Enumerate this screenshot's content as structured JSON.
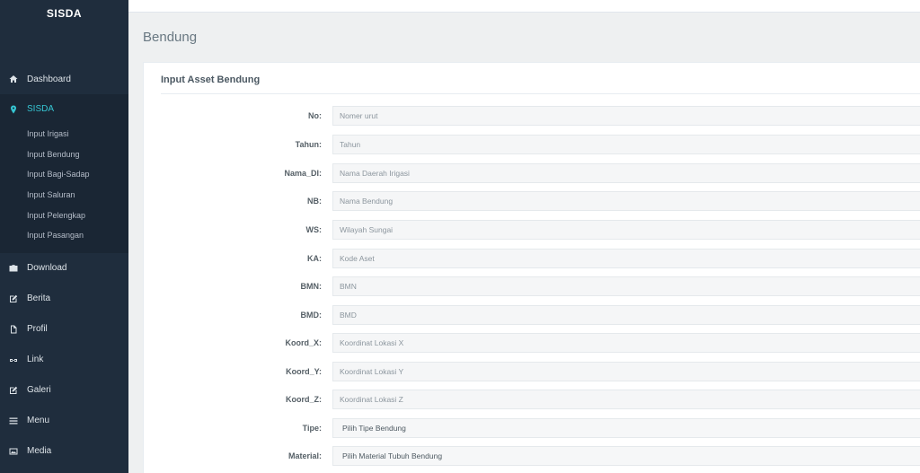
{
  "brand": "SISDA",
  "page_title": "Bendung",
  "panel_title": "Input Asset Bendung",
  "sidebar": {
    "items": [
      {
        "label": "Dashboard",
        "icon": "home-icon"
      },
      {
        "label": "SISDA",
        "icon": "map-pin-icon",
        "active": true
      },
      {
        "label": "Download",
        "icon": "briefcase-icon"
      },
      {
        "label": "Berita",
        "icon": "edit-icon"
      },
      {
        "label": "Profil",
        "icon": "file-icon"
      },
      {
        "label": "Link",
        "icon": "link-icon"
      },
      {
        "label": "Galeri",
        "icon": "edit-icon"
      },
      {
        "label": "Menu",
        "icon": "menu-icon"
      },
      {
        "label": "Media",
        "icon": "media-icon"
      }
    ],
    "sub_items": [
      "Input Irigasi",
      "Input Bendung",
      "Input Bagi-Sadap",
      "Input Saluran",
      "Input Pelengkap",
      "Input Pasangan"
    ]
  },
  "form": {
    "fields": [
      {
        "label": "No:",
        "placeholder": "Nomer urut"
      },
      {
        "label": "Tahun:",
        "placeholder": "Tahun"
      },
      {
        "label": "Nama_DI:",
        "placeholder": "Nama Daerah Irigasi"
      },
      {
        "label": "NB:",
        "placeholder": "Nama Bendung"
      },
      {
        "label": "WS:",
        "placeholder": "Wilayah Sungai"
      },
      {
        "label": "KA:",
        "placeholder": "Kode Aset"
      },
      {
        "label": "BMN:",
        "placeholder": "BMN"
      },
      {
        "label": "BMD:",
        "placeholder": "BMD"
      },
      {
        "label": "Koord_X:",
        "placeholder": "Koordinat Lokasi X"
      },
      {
        "label": "Koord_Y:",
        "placeholder": "Koordinat Lokasi Y"
      },
      {
        "label": "Koord_Z:",
        "placeholder": "Koordinat Lokasi Z"
      },
      {
        "label": "Tipe:",
        "selected": "Pilih Tipe Bendung"
      },
      {
        "label": "Material:",
        "selected": "Pilih Material Tubuh Bendung"
      }
    ]
  },
  "colors": {
    "sidebar_bg": "#1f2d3d",
    "accent": "#36c6d3"
  }
}
